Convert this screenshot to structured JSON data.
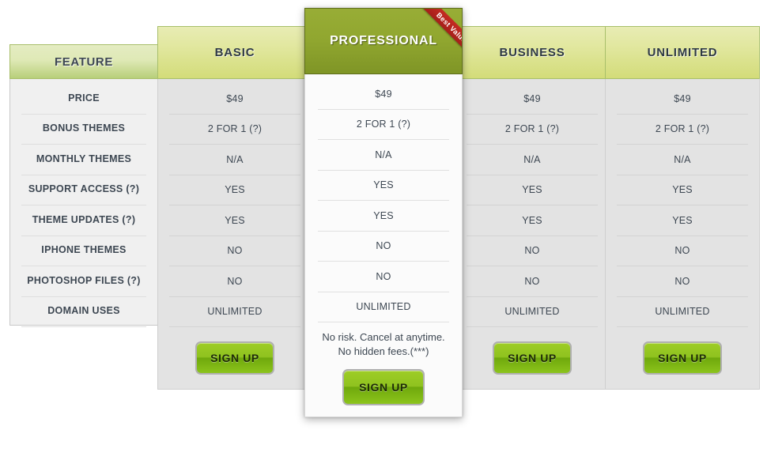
{
  "feature_column": {
    "header": "FEATURE",
    "rows": [
      "PRICE",
      "BONUS THEMES",
      "MONTHLY THEMES",
      "SUPPORT ACCESS (?)",
      "THEME UPDATES (?)",
      "IPHONE THEMES",
      "PHOTOSHOP FILES (?)",
      "DOMAIN USES"
    ]
  },
  "plans": [
    {
      "id": "basic",
      "title": "BASIC",
      "featured": false,
      "values": [
        "$49",
        "2 FOR 1 (?)",
        "N/A",
        "YES",
        "YES",
        "NO",
        "NO",
        "UNLIMITED"
      ],
      "cta": "SIGN UP"
    },
    {
      "id": "professional",
      "title": "PROFESSIONAL",
      "featured": true,
      "ribbon": "Best Value",
      "values": [
        "$49",
        "2 FOR 1 (?)",
        "N/A",
        "YES",
        "YES",
        "NO",
        "NO",
        "UNLIMITED"
      ],
      "note_line1": "No risk. Cancel at anytime.",
      "note_line2": "No hidden fees.(***)",
      "cta": "SIGN UP"
    },
    {
      "id": "business",
      "title": "BUSINESS",
      "featured": false,
      "values": [
        "$49",
        "2 FOR 1 (?)",
        "N/A",
        "YES",
        "YES",
        "NO",
        "NO",
        "UNLIMITED"
      ],
      "cta": "SIGN UP"
    },
    {
      "id": "unlimited",
      "title": "UNLIMITED",
      "featured": false,
      "values": [
        "$49",
        "2 FOR 1 (?)",
        "N/A",
        "YES",
        "YES",
        "NO",
        "NO",
        "UNLIMITED"
      ],
      "cta": "SIGN UP"
    }
  ],
  "colors": {
    "featured_header": "#90a62f",
    "plan_header_start": "#e8ecb4",
    "plan_header_end": "#d3dc79",
    "ribbon": "#b4241d",
    "button_green": "#8fc21f",
    "plan_body_bg": "#e3e3e3",
    "feature_body_bg": "#f0f0f0",
    "text": "#3d4752"
  }
}
